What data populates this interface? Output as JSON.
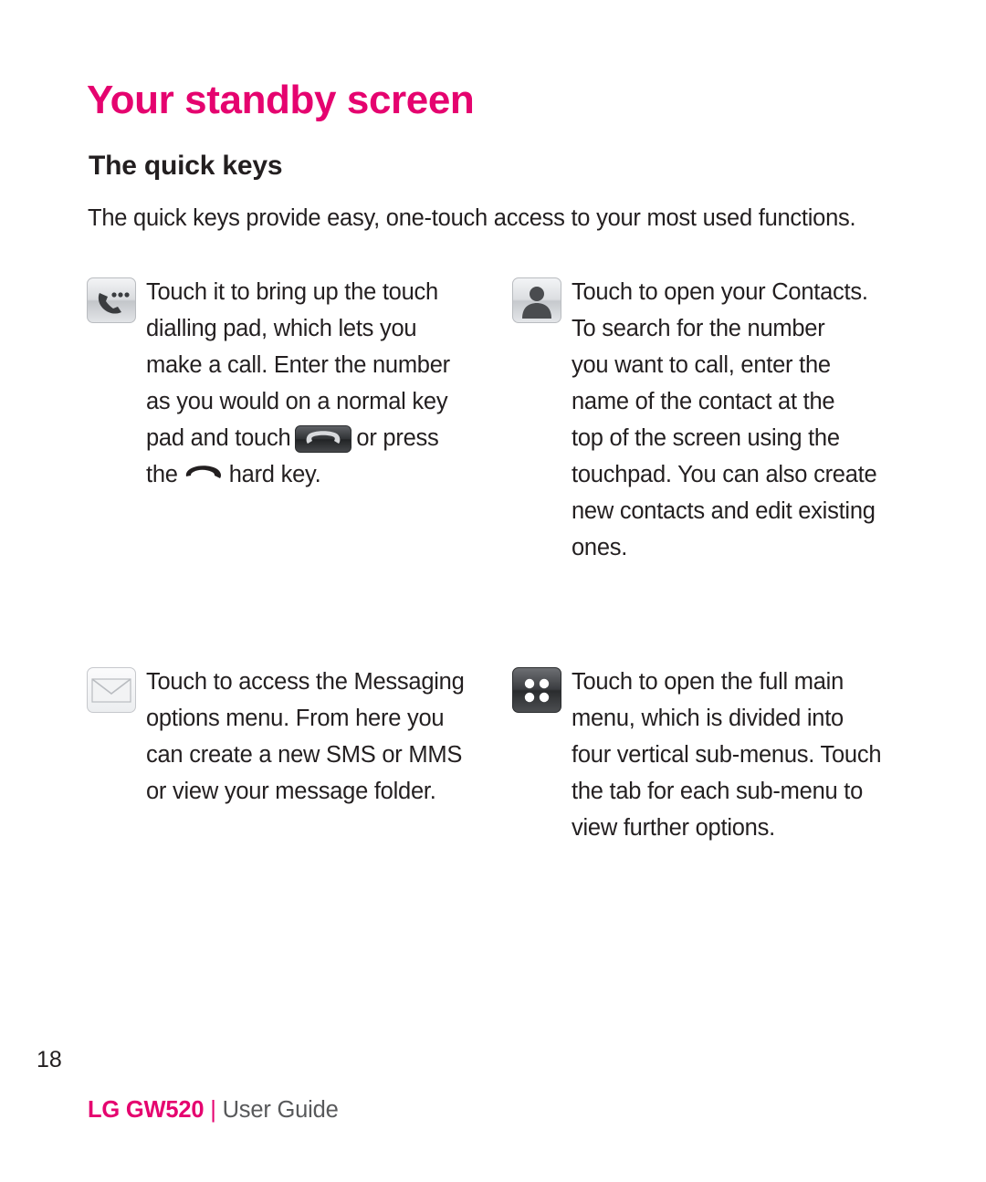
{
  "page": {
    "title": "Your standby screen",
    "subtitle": "The quick keys",
    "intro": "The quick keys provide easy, one-touch access to your most used functions.",
    "page_number": "18",
    "footer_brand": "LG GW520",
    "footer_separator": "|",
    "footer_text": "User Guide",
    "accent_color": "#e5036f",
    "text_color": "#231f20"
  },
  "blocks": {
    "call": {
      "icon": "call-quick-key-icon",
      "line1": "Touch it to bring up the touch",
      "line2": "dialling pad, which lets you",
      "line3": "make a call. Enter the number",
      "line4": "as you would on a normal key",
      "line5_pre": "pad and touch",
      "line5_post": "or press",
      "line6_pre": "the",
      "line6_post": "hard key.",
      "inline_icon_1": "send-key-icon",
      "inline_icon_2": "end-call-hard-key-icon"
    },
    "contacts": {
      "icon": "contacts-quick-key-icon",
      "line1": "Touch to open your Contacts.",
      "line2": "To search for the number",
      "line3": "you want to call, enter the",
      "line4": "name of the contact at the",
      "line5": "top of the screen using the",
      "line6": "touchpad. You can also create",
      "line7": "new contacts and edit existing",
      "line8": "ones."
    },
    "messaging": {
      "icon": "messaging-quick-key-icon",
      "line1": "Touch to access the Messaging",
      "line2": "options menu. From here you",
      "line3": "can create a new SMS or MMS",
      "line4": "or view your message folder."
    },
    "mainmenu": {
      "icon": "main-menu-quick-key-icon",
      "line1": "Touch to open the full main",
      "line2": "menu, which is divided into",
      "line3": "four vertical sub-menus. Touch",
      "line4": "the tab for each sub-menu to",
      "line5": "view further options."
    }
  }
}
